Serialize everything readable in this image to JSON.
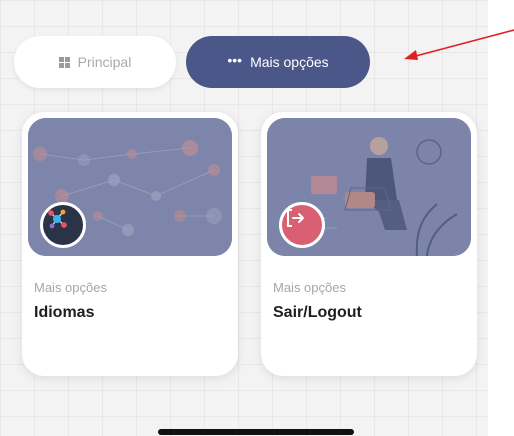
{
  "segmented_control": {
    "principal_label": "Principal",
    "mais_label": "Mais opções",
    "principal_icon": "grid-icon",
    "mais_icon": "more-dots-icon",
    "active": "mais",
    "active_color": "#4c5789"
  },
  "annotation": {
    "arrow_color": "#e02020",
    "arrow_icon": "arrow-left-icon"
  },
  "cards": [
    {
      "subtitle": "Mais opções",
      "title": "Idiomas",
      "icon": "language-network-icon",
      "icon_color": "#2b3346"
    },
    {
      "subtitle": "Mais opções",
      "title": "Sair/Logout",
      "icon": "logout-icon",
      "icon_color": "#d96072"
    }
  ]
}
